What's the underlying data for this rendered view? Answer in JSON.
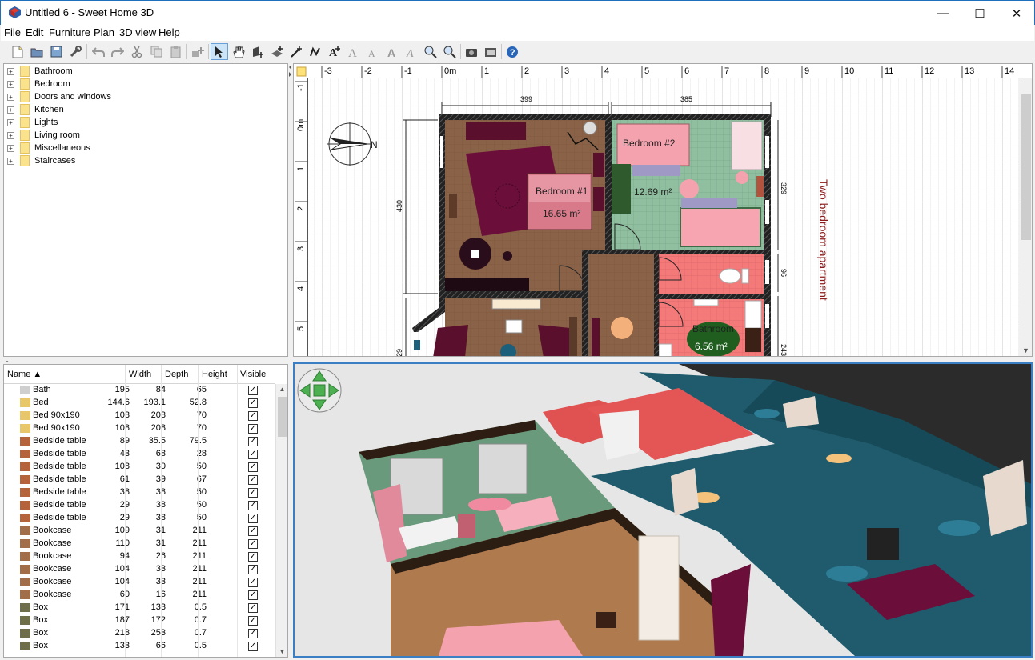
{
  "window": {
    "title": "Untitled 6 - Sweet Home 3D",
    "minimize_glyph": "—",
    "maximize_glyph": "☐",
    "close_glyph": "✕"
  },
  "menu": [
    {
      "label": "File"
    },
    {
      "label": "Edit"
    },
    {
      "label": "Furniture"
    },
    {
      "label": "Plan"
    },
    {
      "label": "3D view"
    },
    {
      "label": "Help"
    }
  ],
  "toolbar": {
    "icons": [
      "new-home-icon",
      "open-icon",
      "save-icon",
      "preferences-icon",
      "undo-icon",
      "redo-icon",
      "cut-icon",
      "copy-icon",
      "paste-icon",
      "add-furniture-icon",
      "select-mode-icon",
      "pan-mode-icon",
      "create-walls-icon",
      "create-rooms-icon",
      "create-dimensions-icon",
      "create-polylines-icon",
      "add-text-icon",
      "increase-text-size-icon",
      "decrease-text-size-icon",
      "bold-text-icon",
      "italic-text-icon",
      "zoom-in-icon",
      "zoom-out-icon",
      "create-photo-icon",
      "create-video-icon",
      "help-icon"
    ]
  },
  "catalog": {
    "categories": [
      {
        "label": "Bathroom"
      },
      {
        "label": "Bedroom"
      },
      {
        "label": "Doors and windows"
      },
      {
        "label": "Kitchen"
      },
      {
        "label": "Lights"
      },
      {
        "label": "Living room"
      },
      {
        "label": "Miscellaneous"
      },
      {
        "label": "Staircases"
      }
    ]
  },
  "furniture_table": {
    "headers": {
      "name": "Name ▲",
      "width": "Width",
      "depth": "Depth",
      "height": "Height",
      "visible": "Visible"
    },
    "rows": [
      {
        "name": "Bath",
        "width": "195",
        "depth": "84",
        "height": "65",
        "visible": "✓",
        "icon": "bath-icon"
      },
      {
        "name": "Bed",
        "width": "144.6",
        "depth": "193.1",
        "height": "52.8",
        "visible": "✓",
        "icon": "bed-icon"
      },
      {
        "name": "Bed 90x190",
        "width": "108",
        "depth": "208",
        "height": "70",
        "visible": "✓",
        "icon": "bed-icon"
      },
      {
        "name": "Bed 90x190",
        "width": "108",
        "depth": "208",
        "height": "70",
        "visible": "✓",
        "icon": "bed-icon"
      },
      {
        "name": "Bedside table",
        "width": "89",
        "depth": "35.5",
        "height": "79.5",
        "visible": "✓",
        "icon": "table-icon"
      },
      {
        "name": "Bedside table",
        "width": "43",
        "depth": "68",
        "height": "28",
        "visible": "✓",
        "icon": "table-icon"
      },
      {
        "name": "Bedside table",
        "width": "108",
        "depth": "30",
        "height": "50",
        "visible": "✓",
        "icon": "table-icon"
      },
      {
        "name": "Bedside table",
        "width": "61",
        "depth": "39",
        "height": "67",
        "visible": "✓",
        "icon": "table-icon"
      },
      {
        "name": "Bedside table",
        "width": "38",
        "depth": "38",
        "height": "50",
        "visible": "✓",
        "icon": "table-icon"
      },
      {
        "name": "Bedside table",
        "width": "29",
        "depth": "38",
        "height": "50",
        "visible": "✓",
        "icon": "table-icon"
      },
      {
        "name": "Bedside table",
        "width": "29",
        "depth": "38",
        "height": "50",
        "visible": "✓",
        "icon": "table-icon"
      },
      {
        "name": "Bookcase",
        "width": "109",
        "depth": "31",
        "height": "211",
        "visible": "✓",
        "icon": "bookcase-icon"
      },
      {
        "name": "Bookcase",
        "width": "110",
        "depth": "31",
        "height": "211",
        "visible": "✓",
        "icon": "bookcase-icon"
      },
      {
        "name": "Bookcase",
        "width": "94",
        "depth": "26",
        "height": "211",
        "visible": "✓",
        "icon": "bookcase-icon"
      },
      {
        "name": "Bookcase",
        "width": "104",
        "depth": "33",
        "height": "211",
        "visible": "✓",
        "icon": "bookcase-icon"
      },
      {
        "name": "Bookcase",
        "width": "104",
        "depth": "33",
        "height": "211",
        "visible": "✓",
        "icon": "bookcase-icon"
      },
      {
        "name": "Bookcase",
        "width": "60",
        "depth": "16",
        "height": "211",
        "visible": "✓",
        "icon": "bookcase-icon"
      },
      {
        "name": "Box",
        "width": "171",
        "depth": "133",
        "height": "0.5",
        "visible": "✓",
        "icon": "box-icon"
      },
      {
        "name": "Box",
        "width": "187",
        "depth": "172",
        "height": "0.7",
        "visible": "✓",
        "icon": "box-icon"
      },
      {
        "name": "Box",
        "width": "218",
        "depth": "253",
        "height": "0.7",
        "visible": "✓",
        "icon": "box-icon"
      },
      {
        "name": "Box",
        "width": "133",
        "depth": "66",
        "height": "0.5",
        "visible": "✓",
        "icon": "box-icon"
      }
    ]
  },
  "plan": {
    "ruler_x_labels": [
      "-3",
      "-2",
      "-1",
      "0m",
      "1",
      "2",
      "3",
      "4",
      "5",
      "6",
      "7",
      "8",
      "9",
      "10",
      "11",
      "12",
      "13",
      "14"
    ],
    "ruler_y_labels": [
      "-1",
      "0m",
      "1",
      "2",
      "3",
      "4",
      "5"
    ],
    "rooms": [
      {
        "name": "Bedroom #1",
        "area": "16.65 m²"
      },
      {
        "name": "Bedroom #2",
        "area": "12.69 m²"
      },
      {
        "name": "Bathroom",
        "area": "6.56 m²"
      }
    ],
    "dimensions": [
      "399",
      "385",
      "430",
      "329",
      "96",
      "29",
      "243"
    ],
    "annotation_text": "Two bedroom apartment",
    "compass_letter": "N"
  },
  "colors": {
    "accent": "#3a7fc4",
    "wall": "#1a1a1a",
    "bedroom1_floor": "#8a6247",
    "bedroom2_floor": "#8fbf9f",
    "bath_floor": "#f47a7a",
    "rug": "#7a0f3c"
  }
}
